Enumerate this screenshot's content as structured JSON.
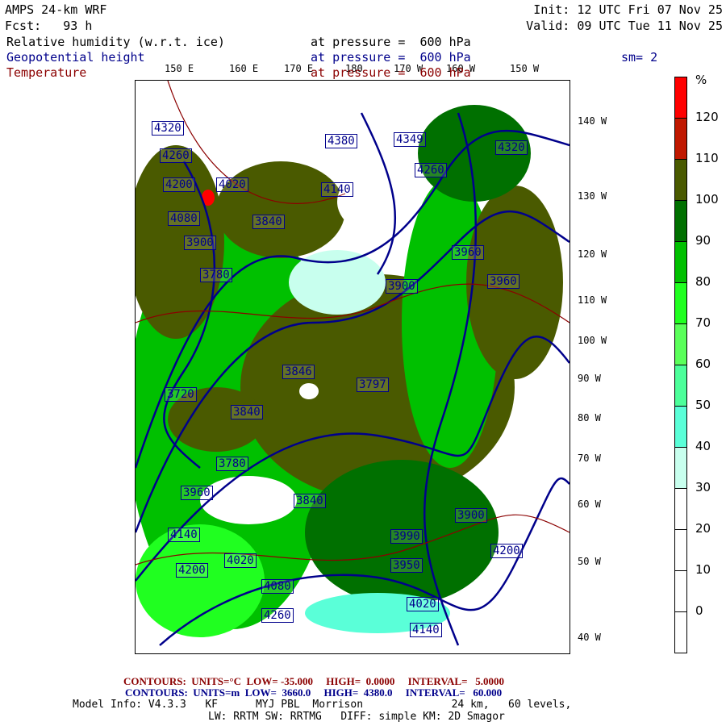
{
  "header": {
    "model": "AMPS 24-km WRF",
    "fcst": "Fcst:   93 h",
    "init": "Init: 12 UTC Fri 07 Nov 25",
    "valid": "Valid: 09 UTC Tue 11 Nov 25"
  },
  "fields": [
    {
      "name": "Relative humidity (w.r.t. ice)",
      "level": "at pressure =  600 hPa"
    },
    {
      "name": "Geopotential height",
      "level": "at pressure =  600 hPa"
    },
    {
      "name": "Temperature",
      "level": "at pressure =  600 hPa"
    }
  ],
  "smoothing": "sm= 2",
  "top_lon_labels": [
    "150 E",
    "160 E",
    "170 E",
    "180",
    "170 W",
    "160 W",
    "150 W"
  ],
  "right_lon_labels": [
    "140 W",
    "130 W",
    "120 W",
    "110 W",
    "100 W",
    "90 W",
    "80 W",
    "70 W",
    "60 W",
    "50 W",
    "40 W"
  ],
  "colorbar": {
    "unit": "%",
    "labels": [
      "120",
      "110",
      "100",
      "90",
      "80",
      "70",
      "60",
      "50",
      "40",
      "30",
      "20",
      "10",
      "0"
    ],
    "colors": [
      "#ff0000",
      "#c01800",
      "#4a5a00",
      "#007000",
      "#00c000",
      "#20ff20",
      "#5aff5a",
      "#4cff9a",
      "#5affd8",
      "#c8ffee",
      "#ffffff",
      "#ffffff",
      "#ffffff",
      "#ffffff"
    ]
  },
  "contour_labels": [
    "4320",
    "4260",
    "4200",
    "4080",
    "3900",
    "3780",
    "3840",
    "4140",
    "4020",
    "4380",
    "4349",
    "4320",
    "4260",
    "3960",
    "3900",
    "3960",
    "3840",
    "3846",
    "3797",
    "3720",
    "3780",
    "3960",
    "3840",
    "4140",
    "4020",
    "4080",
    "4200",
    "4260",
    "3900",
    "3990",
    "4140",
    "4200",
    "4020",
    "3950"
  ],
  "footer": {
    "temp": {
      "label": "CONTOURS:",
      "units": "UNITS=°C",
      "low": "LOW= -35.000",
      "high": "HIGH=  0.0000",
      "interval": "INTERVAL=   5.0000"
    },
    "height": {
      "label": "CONTOURS:",
      "units": "UNITS=m",
      "low": "LOW=  3660.0",
      "high": "HIGH=  4380.0",
      "interval": "INTERVAL=   60.000"
    },
    "model_info": "Model Info: V4.3.3   KF      MYJ PBL  Morrison              24 km,   60 levels,",
    "physics": "LW: RRTM SW: RRTMG   DIFF: simple KM: 2D Smagor"
  }
}
